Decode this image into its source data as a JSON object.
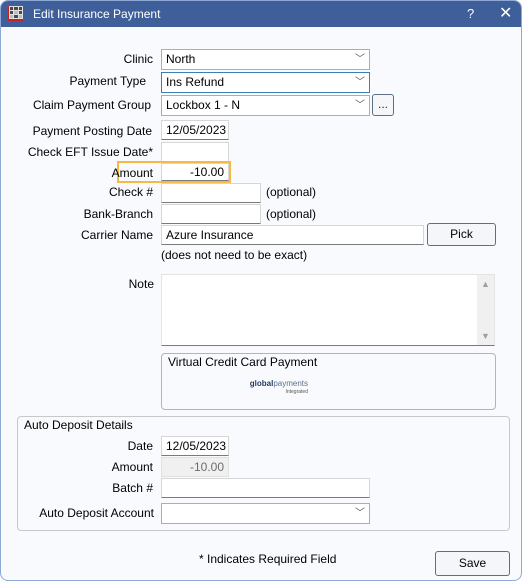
{
  "window": {
    "title": "Edit Insurance Payment",
    "help_label": "?",
    "close_label": "✕"
  },
  "form": {
    "clinic": {
      "label": "Clinic",
      "value": "North"
    },
    "payment_type": {
      "label": "Payment Type",
      "value": "Ins Refund"
    },
    "claim_payment_group": {
      "label": "Claim Payment Group",
      "value": "Lockbox 1 - N",
      "browse_label": "..."
    },
    "payment_posting_date": {
      "label": "Payment Posting Date",
      "value": "12/05/2023"
    },
    "check_eft_issue_date": {
      "label": "Check EFT Issue Date*",
      "value": ""
    },
    "amount": {
      "label": "Amount",
      "value": "-10.00"
    },
    "check_number": {
      "label": "Check #",
      "value": "",
      "hint": "(optional)"
    },
    "bank_branch": {
      "label": "Bank-Branch",
      "value": "",
      "hint": "(optional)"
    },
    "carrier_name": {
      "label": "Carrier Name",
      "value": "Azure Insurance",
      "pick_label": "Pick",
      "hint": "(does not need to be exact)"
    },
    "note": {
      "label": "Note",
      "value": ""
    },
    "vcc": {
      "title": "Virtual Credit Card Payment",
      "logo_bold": "global",
      "logo_light": "payments",
      "logo_sub": "Integrated"
    }
  },
  "auto_deposit": {
    "title": "Auto Deposit Details",
    "date": {
      "label": "Date",
      "value": "12/05/2023"
    },
    "amount": {
      "label": "Amount",
      "value": "-10.00"
    },
    "batch": {
      "label": "Batch #",
      "value": ""
    },
    "account": {
      "label": "Auto Deposit Account",
      "value": ""
    }
  },
  "footer": {
    "required_note": "* Indicates Required Field",
    "save_label": "Save"
  }
}
